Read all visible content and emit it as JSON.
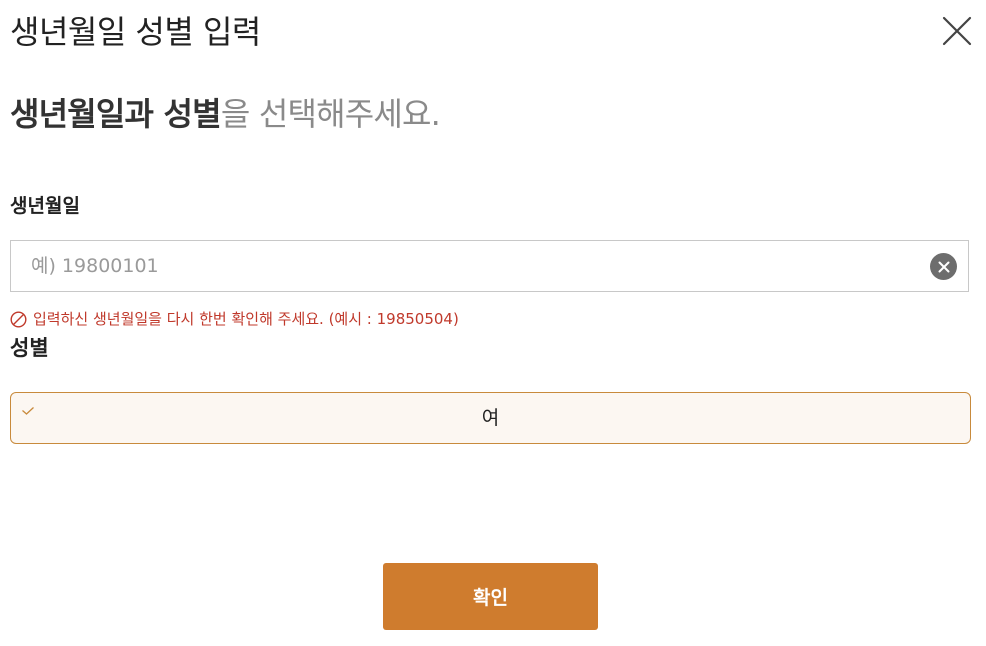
{
  "modal": {
    "title": "생년월일 성별 입력",
    "close_icon": "close-x-icon"
  },
  "headline": {
    "strong": "생년월일과 성별",
    "light": "을 선택해주세요."
  },
  "birth": {
    "label": "생년월일",
    "value": "",
    "placeholder": "예) 19800101",
    "clear_icon": "clear-circle-icon",
    "error": "입력하신 생년월일을 다시 한번 확인해 주세요. (예시 : 19850504)",
    "error_icon": "prohibited-icon",
    "error_color": "#c0392b"
  },
  "gender": {
    "label": "성별",
    "selected": "여",
    "check_icon": "checkmark-icon"
  },
  "actions": {
    "confirm_label": "확인",
    "accent_color": "#cf7c2e"
  }
}
